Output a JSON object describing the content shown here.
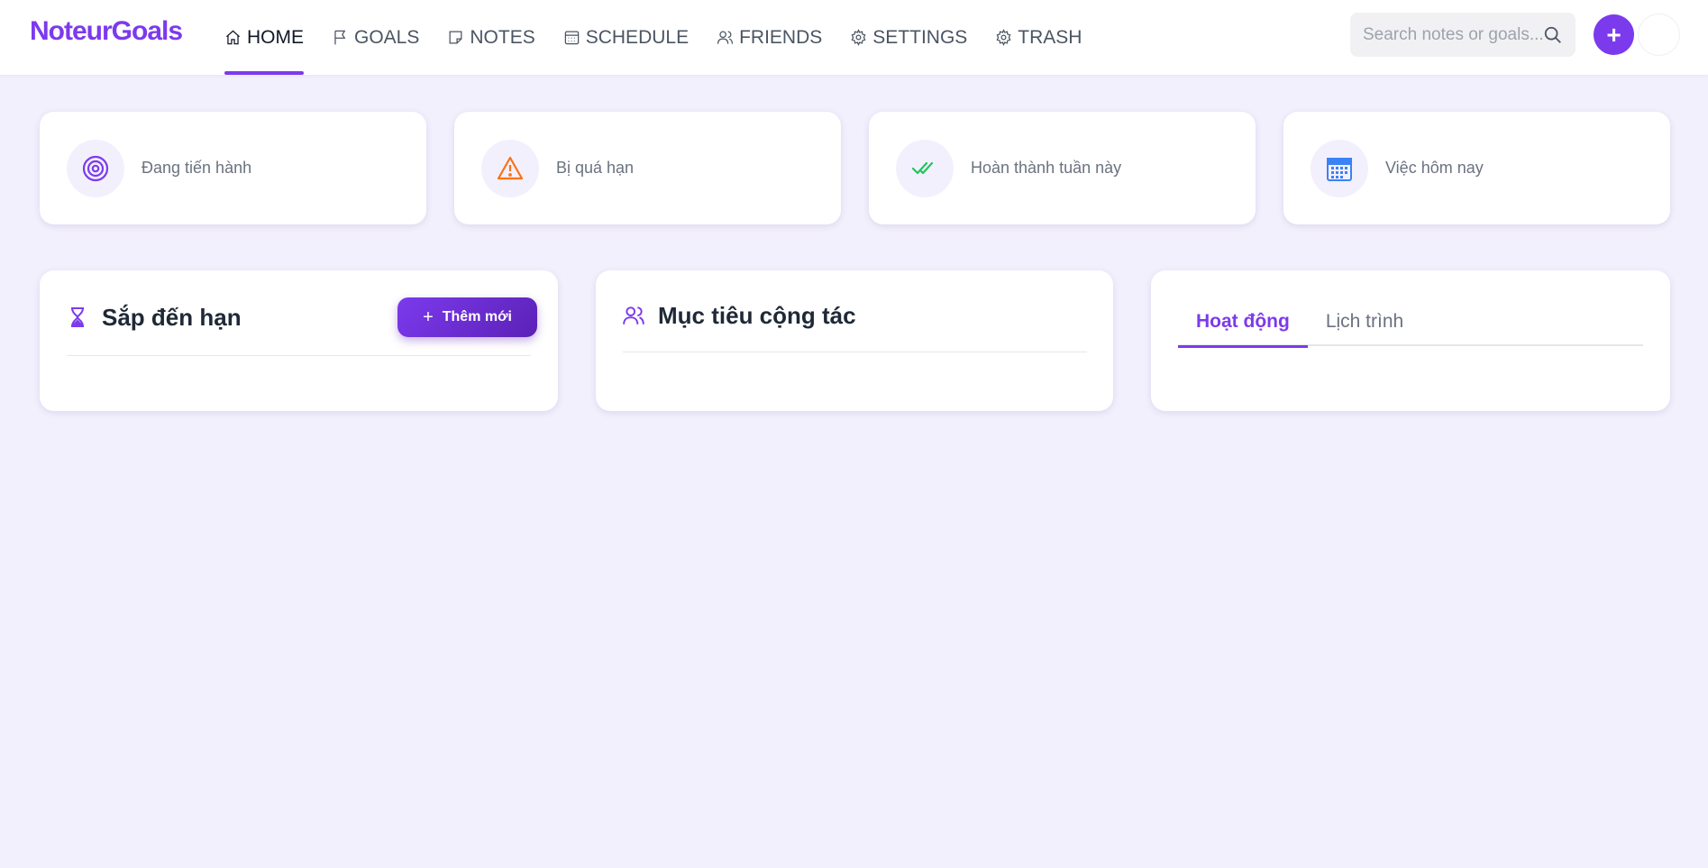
{
  "app": {
    "logo": "NoteurGoals",
    "brand_color": "#7c3aed"
  },
  "nav": {
    "items": [
      {
        "label": "HOME",
        "icon": "home-icon",
        "active": true
      },
      {
        "label": "GOALS",
        "icon": "flag-icon"
      },
      {
        "label": "NOTES",
        "icon": "note-icon"
      },
      {
        "label": "SCHEDULE",
        "icon": "calendar-icon"
      },
      {
        "label": "FRIENDS",
        "icon": "users-icon"
      },
      {
        "label": "SETTINGS",
        "icon": "gear-icon"
      },
      {
        "label": "TRASH",
        "icon": "gear-icon"
      }
    ]
  },
  "search": {
    "placeholder": "Search notes or goals..."
  },
  "header_actions": {
    "add_label": "+"
  },
  "stats": [
    {
      "label": "Đang tiến hành",
      "icon": "target-icon",
      "color": "#7c3aed"
    },
    {
      "label": "Bị quá hạn",
      "icon": "warning-icon",
      "color": "#f97316"
    },
    {
      "label": "Hoàn thành tuần này",
      "icon": "double-check-icon",
      "color": "#22c55e"
    },
    {
      "label": "Việc hôm nay",
      "icon": "calendar-grid-icon",
      "color": "#3b82f6"
    }
  ],
  "panels": {
    "upcoming": {
      "title": "Sắp đến hạn",
      "icon": "hourglass-icon",
      "button_label": "Thêm mới",
      "button_icon": "plus-icon"
    },
    "collab": {
      "title": "Mục tiêu cộng tác",
      "icon": "users-icon"
    },
    "activity": {
      "tabs": [
        {
          "label": "Hoạt động",
          "active": true
        },
        {
          "label": "Lịch trình"
        }
      ]
    }
  }
}
